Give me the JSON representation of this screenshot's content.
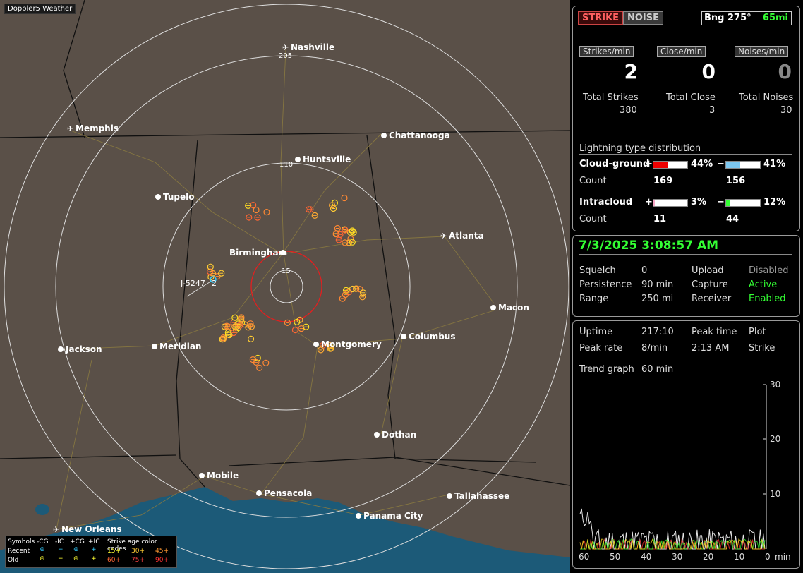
{
  "window_title": "Doppler5 Weather",
  "colors": {
    "map_bg": "#5a5048",
    "water": "#1c5a78",
    "accent_green": "#33ff33",
    "strike_red": "#ff3333",
    "ring": "#ffffff"
  },
  "header": {
    "strike_btn": "STRIKE",
    "noise_btn": "NOISE",
    "bearing": "Bng 275°",
    "distance": "65mi"
  },
  "rates": {
    "strikes_label": "Strikes/min",
    "close_label": "Close/min",
    "noises_label": "Noises/min",
    "strikes_value": "2",
    "close_value": "0",
    "noises_value": "0"
  },
  "totals": {
    "strikes_label": "Total Strikes",
    "close_label": "Total Close",
    "noises_label": "Total Noises",
    "strikes_value": "380",
    "close_value": "3",
    "noises_value": "30"
  },
  "distribution": {
    "title": "Lightning type distribution",
    "cg_label": "Cloud-ground",
    "ic_label": "Intracloud",
    "count_label": "Count",
    "plus_sign": "+",
    "minus_sign": "−",
    "cg_pos_pct": "44%",
    "cg_neg_pct": "41%",
    "cg_pos_count": "169",
    "cg_neg_count": "156",
    "ic_pos_pct": "3%",
    "ic_neg_pct": "12%",
    "ic_pos_count": "11",
    "ic_neg_count": "44",
    "cg_pos_frac": 0.44,
    "cg_neg_frac": 0.41,
    "ic_pos_frac": 0.03,
    "ic_neg_frac": 0.12
  },
  "status": {
    "datetime": "7/3/2025 3:08:57 AM",
    "squelch_label": "Squelch",
    "squelch_value": "0",
    "persistence_label": "Persistence",
    "persistence_value": "90 min",
    "range_label": "Range",
    "range_value": "250 mi",
    "upload_label": "Upload",
    "upload_value": "Disabled",
    "capture_label": "Capture",
    "capture_value": "Active",
    "receiver_label": "Receiver",
    "receiver_value": "Enabled"
  },
  "stats": {
    "uptime_label": "Uptime",
    "uptime_value": "217:10",
    "peak_time_label": "Peak time",
    "peak_time_value": "2:13 AM",
    "plot_label": "Plot",
    "plot_value": "Strike",
    "peak_rate_label": "Peak rate",
    "peak_rate_value": "8/min",
    "trend_label": "Trend graph",
    "trend_value": "60 min"
  },
  "trend_axis": {
    "y_ticks": [
      "30",
      "20",
      "10"
    ],
    "x_ticks": [
      "60",
      "50",
      "40",
      "30",
      "20",
      "10",
      "0"
    ],
    "unit": "min"
  },
  "map": {
    "cities": [
      "Nashville",
      "Memphis",
      "Chattanooga",
      "Huntsville",
      "Tupelo",
      "Atlanta",
      "Birmingham",
      "Macon",
      "Columbus",
      "Montgomery",
      "Jackson",
      "Meridian",
      "Dothan",
      "Mobile",
      "Pensacola",
      "Tallahassee",
      "Panama City",
      "New Orleans"
    ],
    "ring_labels": [
      "205",
      "110",
      "15"
    ],
    "tag_label": "J-5247",
    "tag_value": "2"
  },
  "legend": {
    "symbols_label": "Symbols",
    "cg_neg": "-CG",
    "ic_neg": "-IC",
    "cg_pos": "+CG",
    "ic_pos": "+IC",
    "age_label": "Strike age color codes",
    "recent_label": "Recent",
    "old_label": "Old",
    "age_15": "15+",
    "age_30": "30+",
    "age_45": "45+",
    "age_60": "60+",
    "age_75": "75+",
    "age_90": "90+"
  }
}
